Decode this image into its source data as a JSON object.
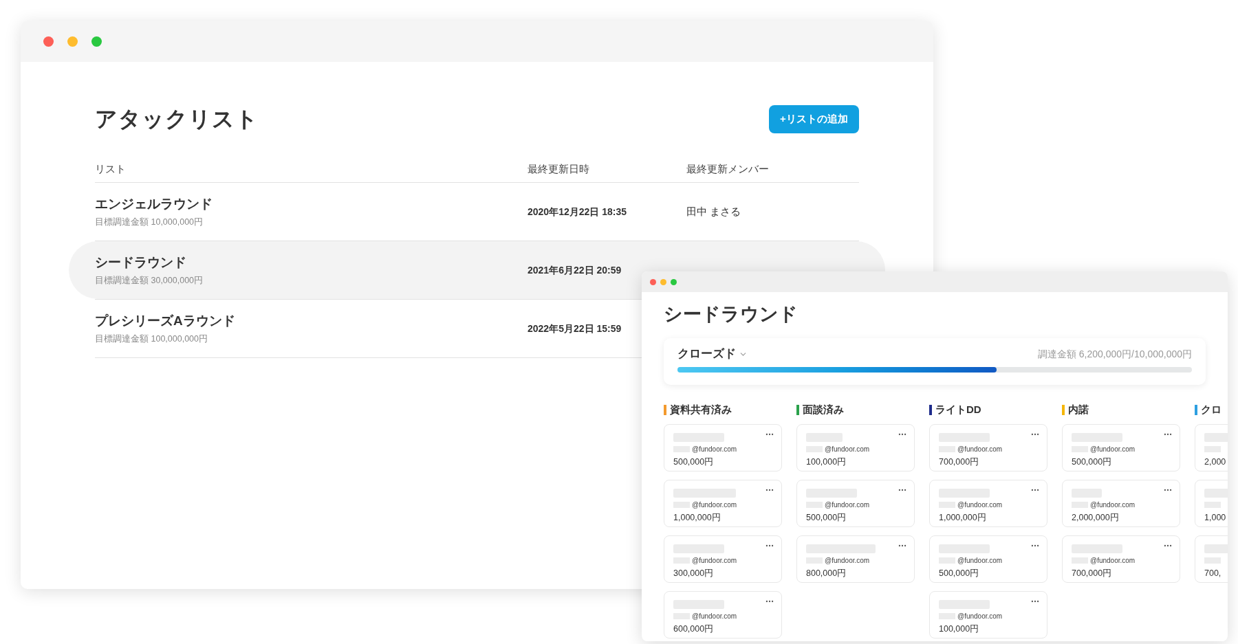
{
  "main_window": {
    "title": "アタックリスト",
    "add_button": "+リストの追加",
    "columns": [
      "リスト",
      "最終更新日時",
      "最終更新メンバー"
    ],
    "rows": [
      {
        "name": "エンジェルラウンド",
        "target": "目標調達金額 10,000,000円",
        "updated": "2020年12月22日 18:35",
        "member": "田中 まさる",
        "selected": false
      },
      {
        "name": "シードラウンド",
        "target": "目標調達金額 30,000,000円",
        "updated": "2021年6月22日 20:59",
        "selected": true
      },
      {
        "name": "プレシリーズAラウンド",
        "target": "目標調達金額 100,000,000円",
        "updated": "2022年5月22日 15:59",
        "selected": false
      }
    ]
  },
  "detail_window": {
    "title": "シードラウンド",
    "status": "クローズド",
    "raised": "調達金額 6,200,000円/10,000,000円",
    "level": 0.62,
    "columns": [
      {
        "label": "資料共有済み",
        "color": "#f39a2e",
        "cards": [
          {
            "email": "@fundoor.com",
            "amount": "500,000円"
          },
          {
            "email": "@fundoor.com",
            "amount": "1,000,000円"
          },
          {
            "email": "@fundoor.com",
            "amount": "300,000円"
          },
          {
            "email": "@fundoor.com",
            "amount": "600,000円"
          }
        ]
      },
      {
        "label": "面談済み",
        "color": "#2ba24c",
        "cards": [
          {
            "email": "@fundoor.com",
            "amount": "100,000円"
          },
          {
            "email": "@fundoor.com",
            "amount": "500,000円"
          },
          {
            "email": "@fundoor.com",
            "amount": "800,000円"
          }
        ]
      },
      {
        "label": "ライトDD",
        "color": "#1f2d8c",
        "cards": [
          {
            "email": "@fundoor.com",
            "amount": "700,000円"
          },
          {
            "email": "@fundoor.com",
            "amount": "1,000,000円"
          },
          {
            "email": "@fundoor.com",
            "amount": "500,000円"
          },
          {
            "email": "@fundoor.com",
            "amount": "100,000円"
          }
        ]
      },
      {
        "label": "内諾",
        "color": "#f5b70a",
        "cards": [
          {
            "email": "@fundoor.com",
            "amount": "500,000円"
          },
          {
            "email": "@fundoor.com",
            "amount": "2,000,000円"
          },
          {
            "email": "@fundoor.com",
            "amount": "700,000円"
          }
        ]
      },
      {
        "label": "クロ",
        "color": "#2e9fe0",
        "cut": true,
        "cards": [
          {
            "amount": "2,000"
          },
          {
            "amount": "1,000"
          },
          {
            "amount": "700,"
          }
        ]
      }
    ]
  }
}
